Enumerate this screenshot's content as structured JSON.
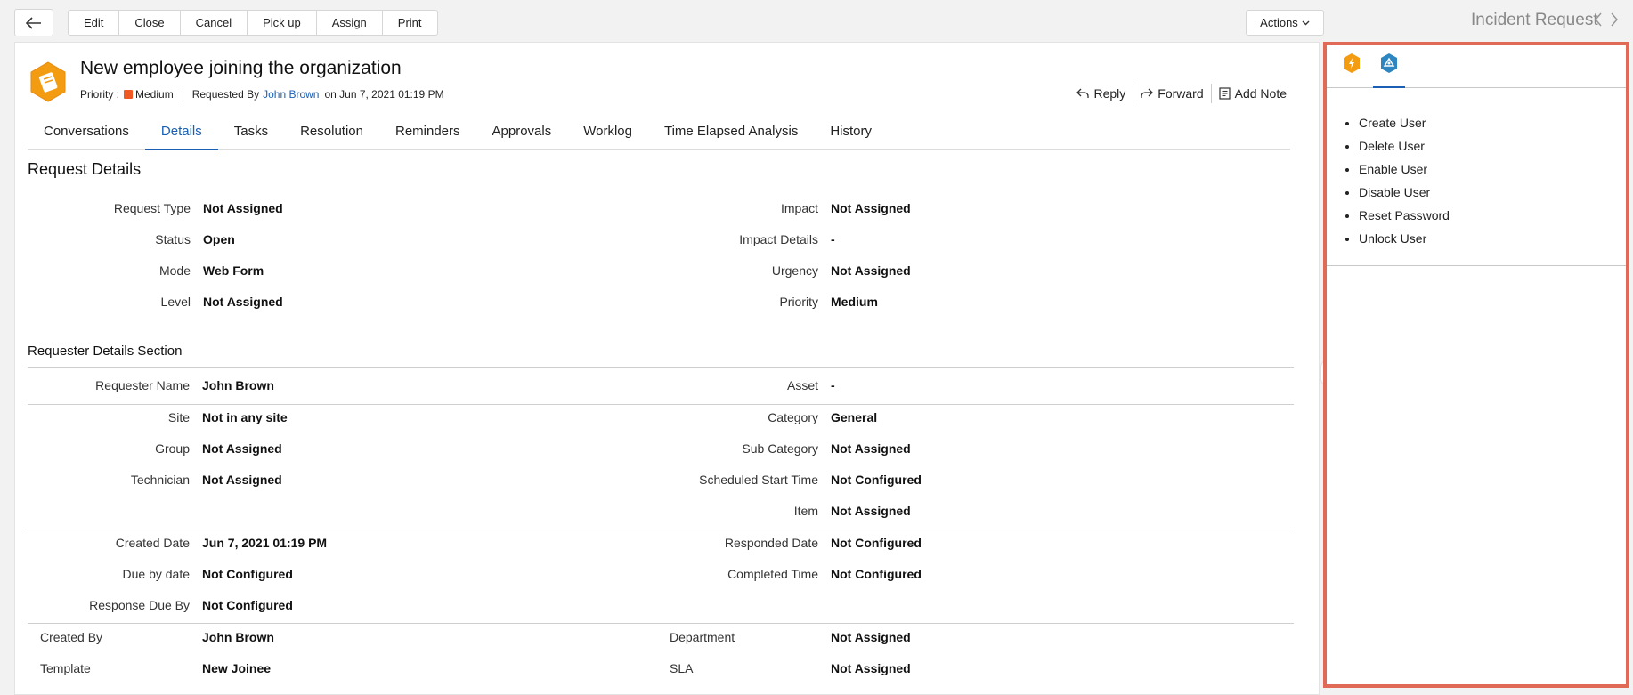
{
  "toolbar": {
    "buttons": [
      "Edit",
      "Close",
      "Cancel",
      "Pick up",
      "Assign",
      "Print"
    ],
    "actions_label": "Actions",
    "module_title": "Incident Request"
  },
  "request": {
    "title": "New employee joining the organization",
    "priority_label": "Priority :",
    "priority_value": "Medium",
    "priority_color": "#f05a22",
    "requested_by_label": "Requested By",
    "requester": "John Brown",
    "requested_on": "on Jun 7, 2021 01:19 PM"
  },
  "quick_actions": {
    "reply": "Reply",
    "forward": "Forward",
    "add_note": "Add Note"
  },
  "tabs": [
    {
      "label": "Conversations",
      "active": false
    },
    {
      "label": "Details",
      "active": true
    },
    {
      "label": "Tasks",
      "active": false
    },
    {
      "label": "Resolution",
      "active": false
    },
    {
      "label": "Reminders",
      "active": false
    },
    {
      "label": "Approvals",
      "active": false
    },
    {
      "label": "Worklog",
      "active": false
    },
    {
      "label": "Time Elapsed Analysis",
      "active": false
    },
    {
      "label": "History",
      "active": false
    }
  ],
  "request_details": {
    "title": "Request Details",
    "left": [
      {
        "label": "Request Type",
        "value": "Not Assigned"
      },
      {
        "label": "Status",
        "value": "Open"
      },
      {
        "label": "Mode",
        "value": "Web Form"
      },
      {
        "label": "Level",
        "value": "Not Assigned"
      }
    ],
    "right": [
      {
        "label": "Impact",
        "value": "Not Assigned"
      },
      {
        "label": "Impact Details",
        "value": "-"
      },
      {
        "label": "Urgency",
        "value": "Not Assigned"
      },
      {
        "label": "Priority",
        "value": "Medium"
      }
    ]
  },
  "requester_details": {
    "title": "Requester Details Section",
    "block1_left": [
      {
        "label": "Requester Name",
        "value": "John Brown"
      }
    ],
    "block1_right": [
      {
        "label": "Asset",
        "value": "-"
      }
    ],
    "block2_left": [
      {
        "label": "Site",
        "value": "Not in any site"
      },
      {
        "label": "Group",
        "value": "Not Assigned"
      },
      {
        "label": "Technician",
        "value": "Not Assigned"
      }
    ],
    "block2_right": [
      {
        "label": "Category",
        "value": "General"
      },
      {
        "label": "Sub Category",
        "value": "Not Assigned"
      },
      {
        "label": "Scheduled Start Time",
        "value": "Not Configured"
      },
      {
        "label": "Item",
        "value": "Not Assigned"
      }
    ],
    "block3_left": [
      {
        "label": "Created Date",
        "value": "Jun 7, 2021 01:19 PM"
      },
      {
        "label": "Due by date",
        "value": "Not Configured"
      },
      {
        "label": "Response Due By",
        "value": "Not Configured"
      }
    ],
    "block3_right": [
      {
        "label": "Responded Date",
        "value": "Not Configured"
      },
      {
        "label": "Completed Time",
        "value": "Not Configured"
      }
    ],
    "block4_left": [
      {
        "label": "Created By",
        "value": "John Brown"
      },
      {
        "label": "Template",
        "value": "New Joinee"
      }
    ],
    "block4_right": [
      {
        "label": "Department",
        "value": "Not Assigned"
      },
      {
        "label": "SLA",
        "value": "Not Assigned"
      }
    ]
  },
  "side_panel": {
    "active_tab_icon": "blue-hexagon-icon",
    "other_tab_icon": "orange-hexagon-icon",
    "actions": [
      "Create User",
      "Delete User",
      "Enable User",
      "Disable User",
      "Reset Password",
      "Unlock User"
    ],
    "border_color": "#e06a56"
  }
}
